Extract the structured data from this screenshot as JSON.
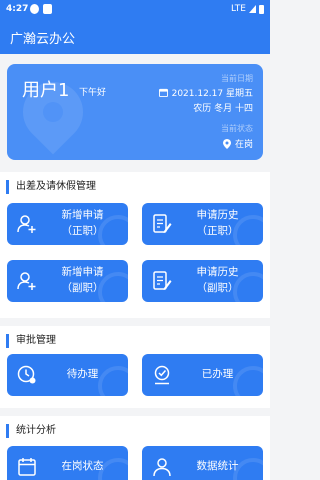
{
  "status_bar": {
    "time": "4:27",
    "network": "LTE"
  },
  "app": {
    "title": "广瀚云办公"
  },
  "user_card": {
    "name": "用户1",
    "greeting": "下午好",
    "date_label": "当前日期",
    "date": "2021.12.17 星期五",
    "lunar_date": "农历 冬月 十四",
    "location_label": "当前状态",
    "status": "在岗"
  },
  "sections": {
    "leave": {
      "title": "出差及请休假管理",
      "tiles": [
        {
          "line1": "新增申请",
          "line2": "（正职）",
          "icon": "person-add-icon"
        },
        {
          "line1": "申请历史",
          "line2": "（正职）",
          "icon": "document-edit-icon"
        },
        {
          "line1": "新增申请",
          "line2": "（副职）",
          "icon": "person-add-icon"
        },
        {
          "line1": "申请历史",
          "line2": "（副职）",
          "icon": "document-edit-icon"
        }
      ]
    },
    "approval": {
      "title": "审批管理",
      "tiles": [
        {
          "label": "待办理",
          "icon": "clock-person-icon"
        },
        {
          "label": "已办理",
          "icon": "done-icon"
        }
      ]
    },
    "stats": {
      "title": "统计分析",
      "tiles": [
        {
          "label": "在岗状态",
          "icon": "calendar-icon"
        },
        {
          "label": "数据统计",
          "icon": "person-chart-icon"
        }
      ]
    }
  },
  "colors": {
    "primary": "#2f7cf2",
    "card": "#4a8ff6",
    "background": "#f3f4f6"
  }
}
